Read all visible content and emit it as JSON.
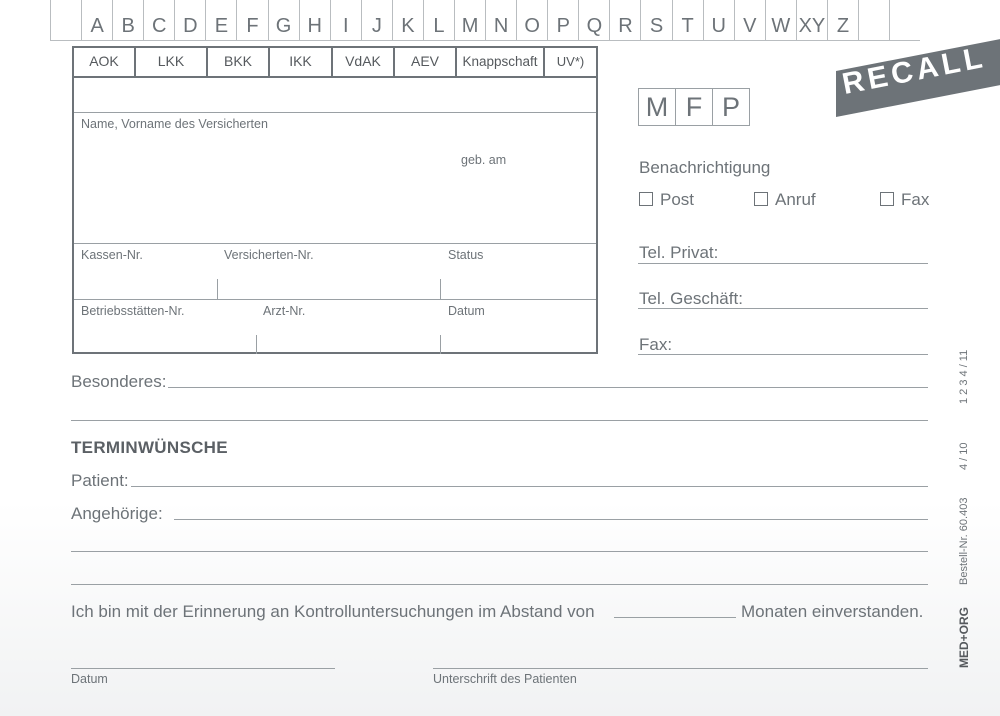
{
  "alphabet": [
    "",
    "A",
    "B",
    "C",
    "D",
    "E",
    "F",
    "G",
    "H",
    "I",
    "J",
    "K",
    "L",
    "M",
    "N",
    "O",
    "P",
    "Q",
    "R",
    "S",
    "T",
    "U",
    "V",
    "W",
    "XY",
    "Z",
    "",
    ""
  ],
  "insurers": [
    "AOK",
    "LKK",
    "BKK",
    "IKK",
    "VdAK",
    "AEV",
    "Knappschaft",
    "UV*)"
  ],
  "insured": {
    "name_label": "Name, Vorname des Versicherten",
    "dob_label": "geb. am",
    "kassen_nr": "Kassen-Nr.",
    "versicherten_nr": "Versicherten-Nr.",
    "status": "Status",
    "betriebsstaetten_nr": "Betriebsstätten-Nr.",
    "arzt_nr": "Arzt-Nr.",
    "datum": "Datum"
  },
  "mfp": [
    "M",
    "F",
    "P"
  ],
  "recall": "RECALL",
  "notification": {
    "title": "Benachrichtigung",
    "options": [
      "Post",
      "Anruf",
      "Fax"
    ]
  },
  "phone": {
    "privat": "Tel. Privat:",
    "geschaeft": "Tel. Geschäft:",
    "fax": "Fax:"
  },
  "besonderes": "Besonderes:",
  "terminwuensche": {
    "title": "TERMINWÜNSCHE",
    "patient": "Patient:",
    "angehoerige": "Angehörige:"
  },
  "consent": {
    "before": "Ich bin mit der Erinnerung an Kontrolluntersuchungen im Abstand von",
    "after": "Monaten einverstanden."
  },
  "signature": {
    "datum": "Datum",
    "unterschrift": "Unterschrift des Patienten"
  },
  "side": {
    "brand": "MED+ORG",
    "order": "Bestell-Nr. 60.403",
    "code1": "4 / 10",
    "code2": "1  2  3  4 / 11"
  }
}
